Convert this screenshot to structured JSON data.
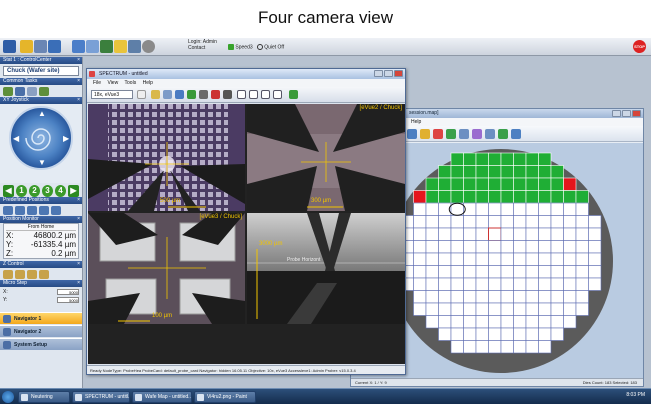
{
  "caption": "Four camera view",
  "colors": {
    "accent": "#2a5aa0",
    "wafer_green": "#1fae35",
    "wafer_red": "#e4141c",
    "stop": "#d22222"
  },
  "toolbar": {
    "login_line1": "Login: Admin",
    "login_line2": "Contact",
    "speed_label": "Speed3",
    "quiet_label": "Quiet Off",
    "stop_label": "STOP"
  },
  "left_panel": {
    "title": "Stat 1 : ControlCenter",
    "chuck_label": "Chuck (Wafer site)",
    "common_tasks": "Common Tasks",
    "joystick": "XY Joystick",
    "nav_numbers": [
      "1",
      "2",
      "3",
      "4"
    ],
    "predefined": "Predefined Positions",
    "position_monitor": "Position Monitor",
    "from_home": "From Home",
    "x_label": "X:",
    "x_value": "46800.2 µm",
    "y_label": "Y:",
    "y_value": "-61335.4 µm",
    "z_label": "Z:",
    "z_value": "0.2 µm",
    "z_control": "Z Control",
    "micro_step": "Micro Step",
    "step_x_label": "X:",
    "step_x": "5000",
    "step_y_label": "Y:",
    "step_y": "5000",
    "nav_buttons": [
      "Navigator 1",
      "Navigator 2",
      "System Setup"
    ]
  },
  "spectrum": {
    "title": "SPECTRUM - untitled",
    "menu": [
      "File",
      "View",
      "Tools",
      "Help"
    ],
    "camera_select": "18x, eVue3",
    "views": [
      {
        "label": "",
        "scale": "500 µm"
      },
      {
        "label": "[eVue2 / Chuck]",
        "scale": "300 µm"
      },
      {
        "label": "[eVue3 / Chuck]",
        "scale": "100 µm"
      },
      {
        "label": "",
        "scale": "3000 µm",
        "extra": "Probe Horizont"
      }
    ],
    "status": "Ready          NodeType: ProbeHea    ProbeCard: default_probe_card    Navigator: hidden    16.05.11   Objective: 10x, eVue3    Accessleve1: Admin    Prober: v15.0.3.4"
  },
  "wafer": {
    "menu_suffix": "Help",
    "title_fragment": "session.map]",
    "status_left": "Current X: 1 / Y: 9",
    "status_right": "Dies Count: 183  Selected: 183",
    "rows": [
      {
        "start": 4,
        "count": 8,
        "fill": "green"
      },
      {
        "start": 3,
        "count": 10,
        "fill": "green"
      },
      {
        "start": 2,
        "count": 12,
        "fill": "green"
      },
      {
        "start": 1,
        "count": 14,
        "fill": "green"
      },
      {
        "start": 1,
        "count": 14,
        "fill": "white"
      },
      {
        "start": 0,
        "count": 16,
        "fill": "white"
      },
      {
        "start": 0,
        "count": 16,
        "fill": "white"
      },
      {
        "start": 0,
        "count": 16,
        "fill": "white"
      },
      {
        "start": 0,
        "count": 16,
        "fill": "white"
      },
      {
        "start": 0,
        "count": 16,
        "fill": "white"
      },
      {
        "start": 0,
        "count": 16,
        "fill": "white"
      },
      {
        "start": 1,
        "count": 14,
        "fill": "white"
      },
      {
        "start": 1,
        "count": 14,
        "fill": "white"
      },
      {
        "start": 2,
        "count": 12,
        "fill": "white"
      },
      {
        "start": 3,
        "count": 10,
        "fill": "white"
      },
      {
        "start": 4,
        "count": 8,
        "fill": "white"
      }
    ],
    "red_cells": [
      [
        2,
        13
      ],
      [
        3,
        1
      ]
    ],
    "marked_cell": [
      6,
      7
    ]
  },
  "taskbar": {
    "items": [
      "Neutering",
      "SPECTRUM - untitl...",
      "Wafe Map - untitled...",
      "Vi4ru2.png - Paint"
    ],
    "clock": "8:03 PM"
  }
}
